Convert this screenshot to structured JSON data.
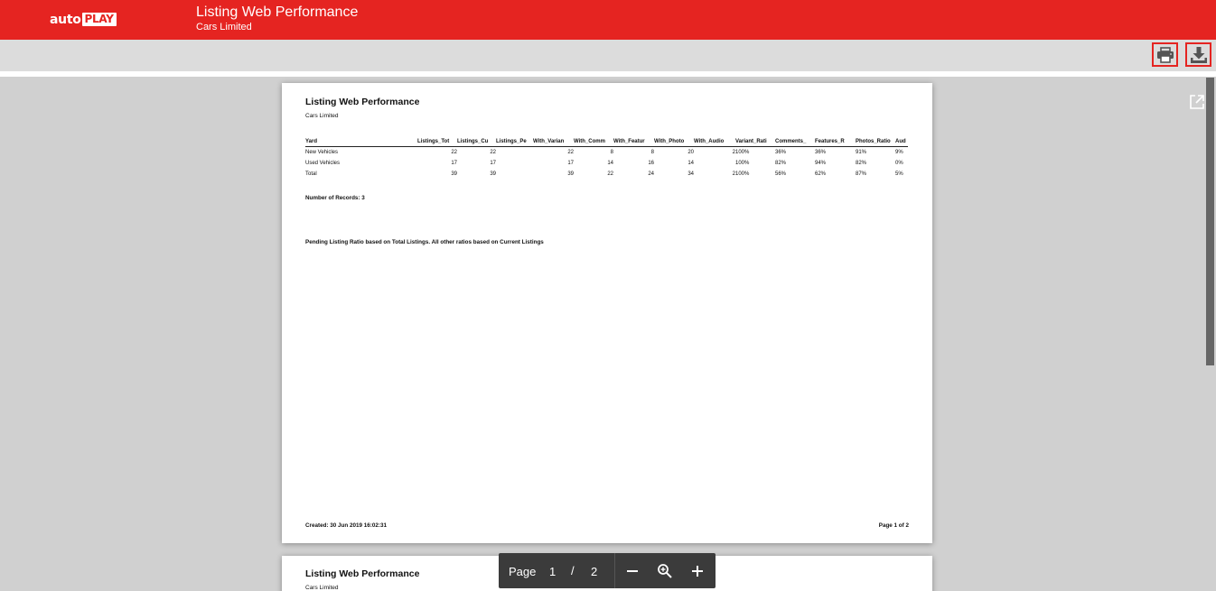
{
  "header": {
    "logo_auto": "auto",
    "logo_play": "PLAY",
    "title": "Listing Web Performance",
    "subtitle": "Cars Limited"
  },
  "toolbar": {
    "print_icon": "printer-icon",
    "download_icon": "download-icon"
  },
  "report": {
    "title": "Listing Web Performance",
    "subtitle": "Cars Limited",
    "columns": [
      "Yard",
      "Listings_Tot",
      "Listings_Cu",
      "Listings_Pe",
      "With_Varian",
      "With_Comm",
      "With_Featur",
      "With_Photo",
      "With_Audio",
      "Variant_Rati",
      "Comments_",
      "Features_R",
      "Photos_Ratio",
      "Aud"
    ],
    "rows": [
      [
        "New Vehicles",
        "22",
        "22",
        "",
        "22",
        "8",
        "8",
        "20",
        "2",
        "100%",
        "36%",
        "36%",
        "91%",
        "9%"
      ],
      [
        "Used Vehicles",
        "17",
        "17",
        "",
        "17",
        "14",
        "16",
        "14",
        "",
        "100%",
        "82%",
        "94%",
        "82%",
        "0%"
      ],
      [
        "Total",
        "39",
        "39",
        "",
        "39",
        "22",
        "24",
        "34",
        "2",
        "100%",
        "56%",
        "62%",
        "87%",
        "5%"
      ]
    ],
    "records": "Number of Records: 3",
    "note": "Pending Listing Ratio based on Total Listings. All other ratios based on Current Listings",
    "created": "Created: 30 Jun 2019 16:02:31",
    "page_of": "Page 1 of 2"
  },
  "pager": {
    "label": "Page",
    "current": "1",
    "separator": "/",
    "total": "2"
  },
  "colors": {
    "brand": "#e52421",
    "toolbar": "#dcdcdc",
    "viewer_bg": "#d0d0d0",
    "pager_bg": "#3b3b3b"
  }
}
